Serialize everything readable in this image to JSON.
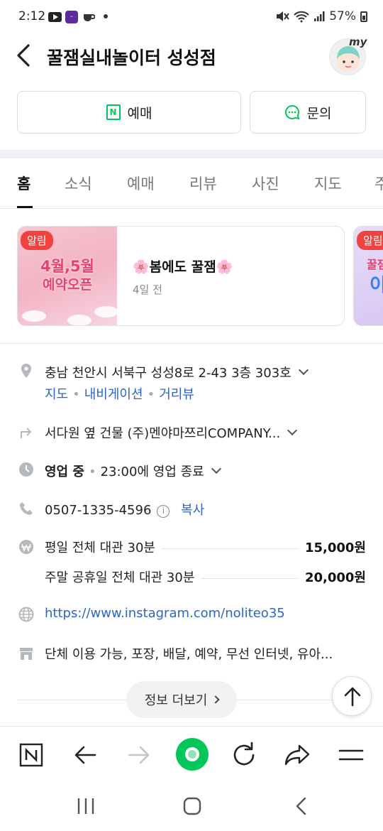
{
  "status_bar": {
    "time": "2:12",
    "battery": "57%"
  },
  "header": {
    "title": "꿀잼실내놀이터 성성점",
    "my_label": "my"
  },
  "actions": {
    "reserve_label": "예매",
    "inquiry_label": "문의"
  },
  "tabs": [
    {
      "label": "홈",
      "active": true
    },
    {
      "label": "소식"
    },
    {
      "label": "예매"
    },
    {
      "label": "리뷰"
    },
    {
      "label": "사진"
    },
    {
      "label": "지도"
    },
    {
      "label": "주"
    }
  ],
  "notices": [
    {
      "badge": "알림",
      "image_line1": "4월,5월",
      "image_line2": "예약오픈",
      "title": "🌸봄에도 꿀잼🌸",
      "time": "4일 전"
    },
    {
      "badge": "알림",
      "image_line1": "꿀잼",
      "image_line2": "이"
    }
  ],
  "info": {
    "address": "충남 천안시 서북구 성성8로 2-43 3층 303호",
    "address_links": [
      "지도",
      "내비게이션",
      "거리뷰"
    ],
    "directions": "서다원 옆 건물 (주)멘야마쯔리COMPANY...",
    "hours_status": "영업 중",
    "hours_detail": "23:00에 영업 종료",
    "phone": "0507-1335-4596",
    "copy_label": "복사",
    "prices": [
      {
        "name": "평일 전체 대관 30분",
        "price": "15,000원"
      },
      {
        "name": "주말 공휴일 전체 대관 30분",
        "price": "20,000원"
      }
    ],
    "website": "https://www.instagram.com/noliteo35",
    "amenities": "단체 이용 가능, 포장, 배달, 예약, 무선 인터넷, 유아..."
  },
  "more_info_label": "정보 더보기",
  "colors": {
    "brand_green": "#03c75a",
    "link_blue": "#2d64c8",
    "badge_red": "#f0433f"
  }
}
